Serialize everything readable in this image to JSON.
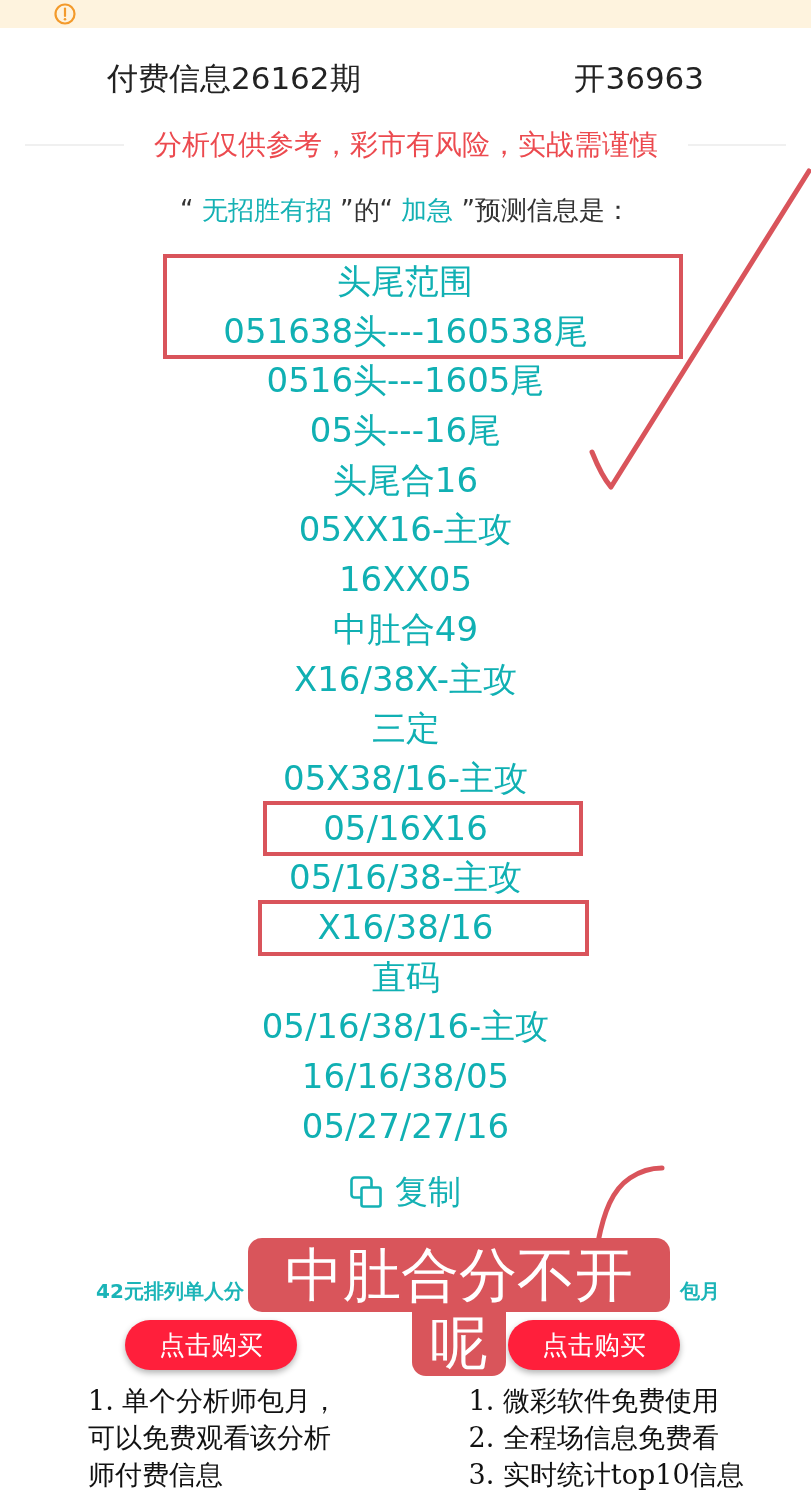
{
  "header": {
    "issue": "付费信息26162期",
    "result": "开36963"
  },
  "disclaimer": "分析仅供参考，彩市有风险，实战需谨慎",
  "intro": [
    {
      "kind": "plain",
      "text": "“ "
    },
    {
      "kind": "name",
      "text": "无招胜有招"
    },
    {
      "kind": "plain",
      "text": " ”的“ "
    },
    {
      "kind": "name",
      "text": "加急"
    },
    {
      "kind": "plain",
      "text": " ”预测信息是："
    }
  ],
  "predictions": [
    {
      "text": "头尾范围",
      "boxed": true
    },
    {
      "text": "051638头---160538尾",
      "boxed": true
    },
    {
      "text": "0516头---1605尾",
      "boxed": false
    },
    {
      "text": "05头---16尾",
      "boxed": false
    },
    {
      "text": "头尾合16",
      "boxed": false
    },
    {
      "text": "05XX16-主攻",
      "boxed": false
    },
    {
      "text": "16XX05",
      "boxed": false
    },
    {
      "text": "中肚合49",
      "boxed": false
    },
    {
      "text": "X16/38X-主攻",
      "boxed": false
    },
    {
      "text": "三定",
      "boxed": false
    },
    {
      "text": "05X38/16-主攻",
      "boxed": false
    },
    {
      "text": "05/16X16",
      "boxed": true
    },
    {
      "text": "05/16/38-主攻",
      "boxed": false
    },
    {
      "text": "X16/38/16",
      "boxed": true
    },
    {
      "text": "直码",
      "boxed": false
    },
    {
      "text": "05/16/38/16-主攻",
      "boxed": false
    },
    {
      "text": "16/16/38/05",
      "boxed": false
    },
    {
      "text": "05/27/27/16",
      "boxed": false
    }
  ],
  "copy_button": "复制",
  "plans": [
    {
      "title": "42元排列单人分",
      "button": "点击购买",
      "features": [
        "1. 单个分析师包月，可以免费观看该分析师付费信息"
      ]
    },
    {
      "title": "包月",
      "button": "点击购买",
      "features": [
        "1. 微彩软件免费使用",
        "2. 全程场信息免费看",
        "3. 实时统计top10信息"
      ]
    }
  ],
  "annotation": {
    "note_lines": [
      "中肚合分不开",
      "呢"
    ]
  }
}
